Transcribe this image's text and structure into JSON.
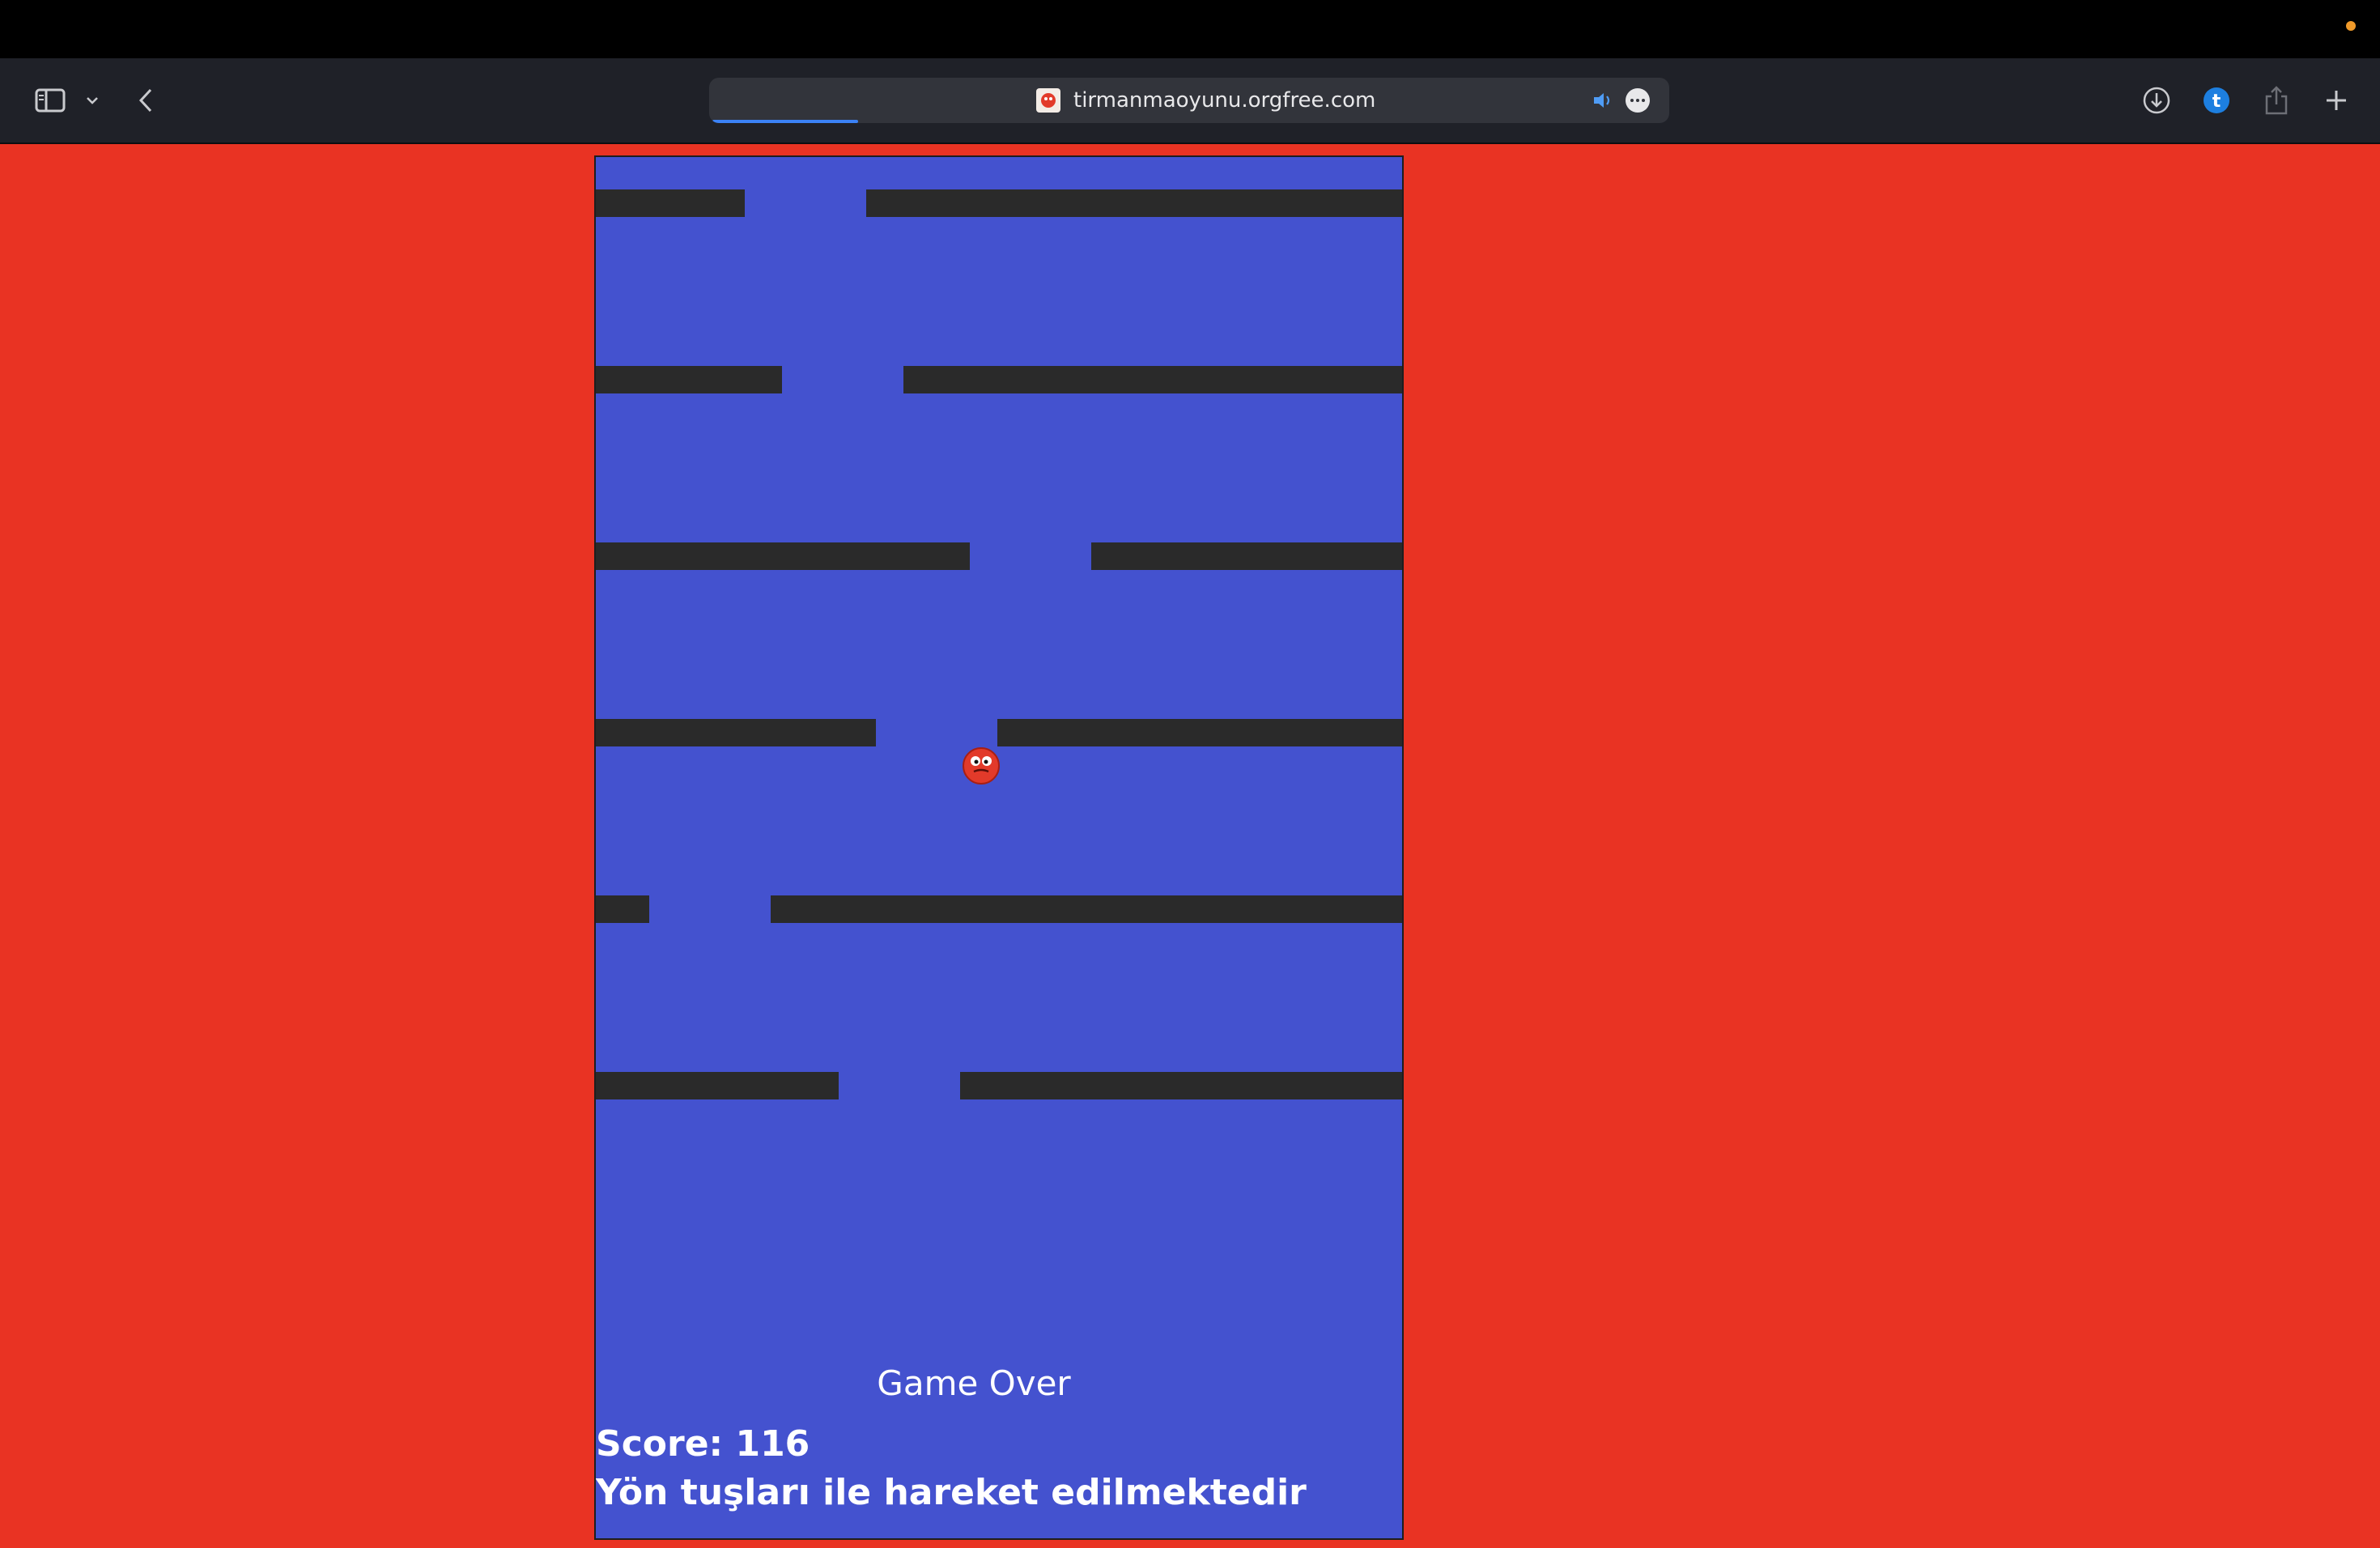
{
  "browser": {
    "url": "tirmanmaoyunu.orgfree.com",
    "icons": {
      "sidebar": "sidebar-icon",
      "chevron": "chevron-down-icon",
      "back": "back-arrow-icon",
      "favicon": "site-favicon-icon",
      "audio": "speaker-icon",
      "more": "more-icon",
      "download": "download-icon",
      "extension": "extension-icon",
      "share": "share-icon",
      "new_tab": "plus-icon"
    },
    "colors": {
      "chrome": "#1f2128",
      "url_field": "#32343b",
      "progress": "#3b82f6",
      "accent_dot": "#f09a2a"
    }
  },
  "page": {
    "background": "#e93323"
  },
  "game": {
    "background": "#4452cf",
    "platform_color": "#2a2a2a",
    "player_color": "#e23a2a",
    "status": "Game Over",
    "score_text": "Score: 116",
    "score": 116,
    "instructions": "Yön tuşları ile hareket edilmektedir"
  }
}
